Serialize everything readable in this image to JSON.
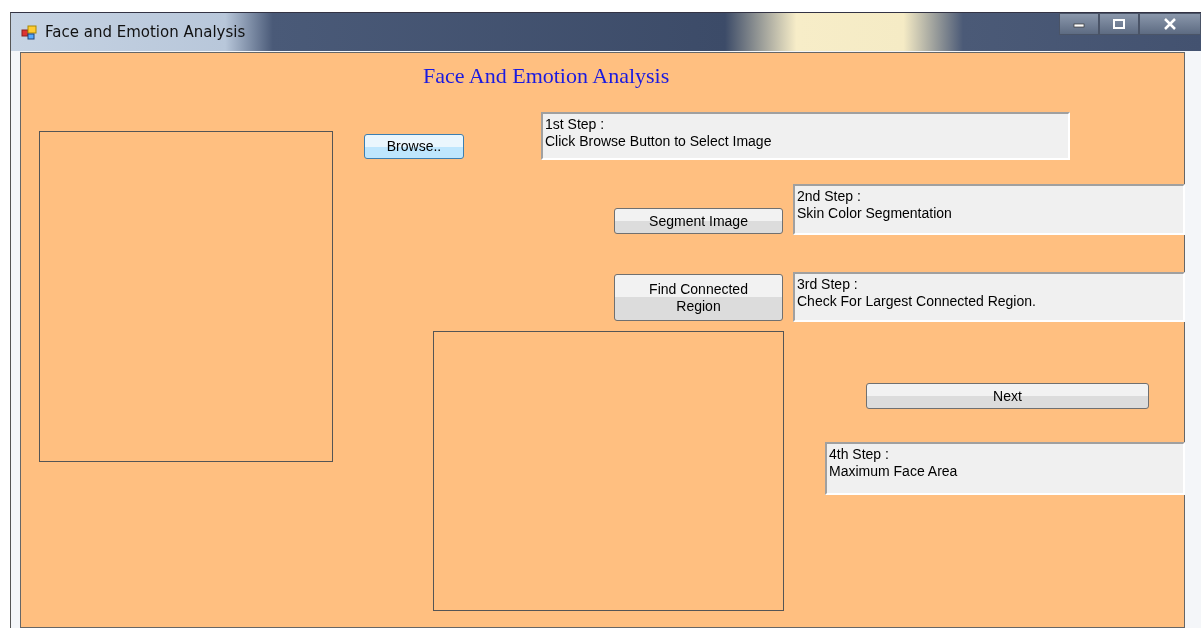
{
  "window": {
    "title": "Face and Emotion Analysis"
  },
  "heading": "Face And Emotion Analysis",
  "controls": [
    {
      "kind": "button",
      "label": "Browse..",
      "focused": true
    },
    {
      "kind": "textbox",
      "lines": [
        "1st Step :",
        "Click Browse Button to Select Image"
      ]
    },
    {
      "kind": "button",
      "label": "Segment Image",
      "focused": false
    },
    {
      "kind": "textbox",
      "lines": [
        "2nd Step :",
        "Skin Color Segmentation"
      ]
    },
    {
      "kind": "button",
      "label": "Find Connected Region",
      "focused": false
    },
    {
      "kind": "textbox",
      "lines": [
        "3rd Step :",
        "Check For Largest Connected Region."
      ]
    },
    {
      "kind": "button",
      "label": "Next",
      "focused": false
    },
    {
      "kind": "textbox",
      "lines": [
        "4th Step :",
        "Maximum Face Area"
      ]
    }
  ]
}
